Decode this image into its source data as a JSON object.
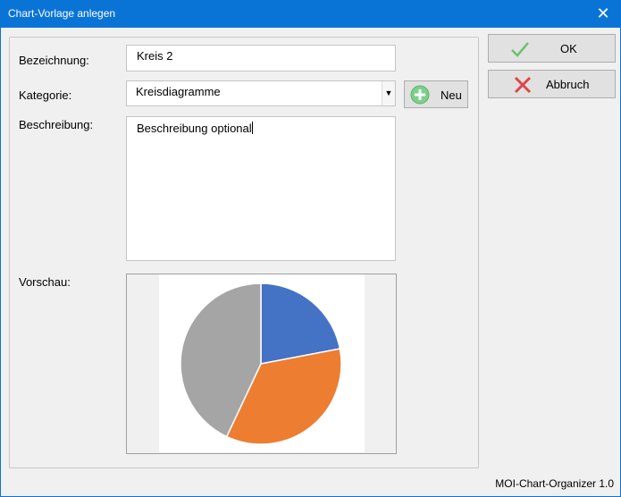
{
  "window": {
    "title": "Chart-Vorlage anlegen",
    "close_icon": "close-icon",
    "status_text": "MOI-Chart-Organizer 1.0"
  },
  "form": {
    "name_label": "Bezeichnung:",
    "name_value": "Kreis 2",
    "category_label": "Kategorie:",
    "category_value": "Kreisdiagramme",
    "new_button_label": "Neu",
    "description_label": "Beschreibung:",
    "description_value": "Beschreibung optional",
    "preview_label": "Vorschau:"
  },
  "buttons": {
    "ok_label": "OK",
    "cancel_label": "Abbruch"
  },
  "colors": {
    "titlebar": "#0a74d6",
    "pie_blue": "#4472c4",
    "pie_orange": "#ed7d31",
    "pie_gray": "#a5a5a5",
    "ok_check": "#6cc26c",
    "cancel_x": "#e0454b",
    "add_icon": "#7bd08a"
  },
  "chart_data": {
    "type": "pie",
    "values": [
      22,
      35,
      43
    ],
    "colors": [
      "#4472c4",
      "#ed7d31",
      "#a5a5a5"
    ],
    "title": ""
  }
}
